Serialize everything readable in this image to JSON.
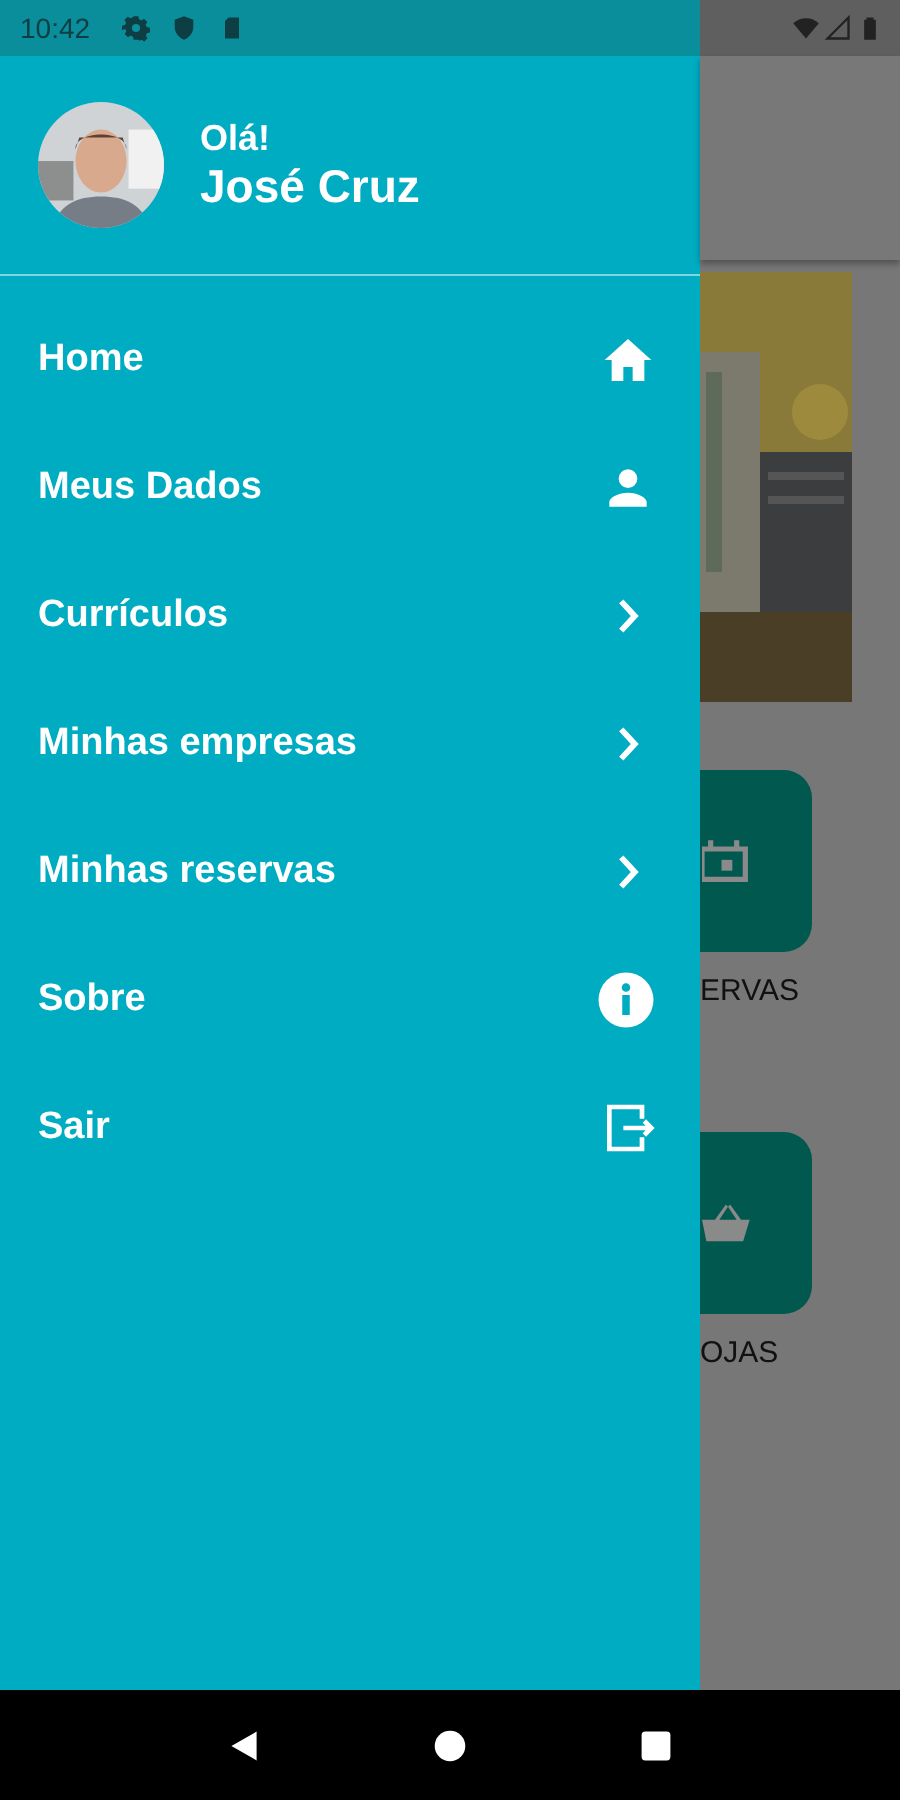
{
  "status_bar": {
    "time": "10:42"
  },
  "drawer": {
    "greeting": "Olá!",
    "user_name": "José Cruz",
    "items": [
      {
        "label": "Home",
        "kind": "home"
      },
      {
        "label": "Meus Dados",
        "kind": "person"
      },
      {
        "label": "Currículos",
        "kind": "chevron"
      },
      {
        "label": "Minhas empresas",
        "kind": "chevron"
      },
      {
        "label": "Minhas reservas",
        "kind": "chevron"
      },
      {
        "label": "Sobre",
        "kind": "info"
      },
      {
        "label": "Sair",
        "kind": "exit"
      }
    ]
  },
  "background_screen": {
    "tiles": [
      {
        "label": "ERVAS",
        "kind": "calendar"
      },
      {
        "label": "OJAS",
        "kind": "basket"
      }
    ]
  }
}
